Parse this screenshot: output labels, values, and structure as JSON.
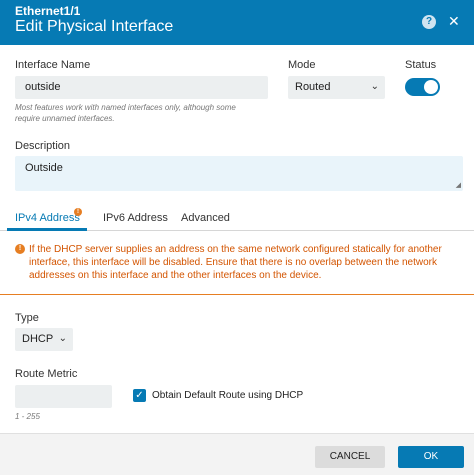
{
  "header": {
    "subtitle": "Ethernet1/1",
    "title": "Edit Physical Interface",
    "help_glyph": "?",
    "close_glyph": "✕"
  },
  "form": {
    "interface_name": {
      "label": "Interface Name",
      "value": "outside",
      "hint": "Most features work with named interfaces only, although some require unnamed interfaces."
    },
    "mode": {
      "label": "Mode",
      "value": "Routed"
    },
    "status": {
      "label": "Status",
      "enabled": true
    },
    "description": {
      "label": "Description",
      "value": "Outside"
    }
  },
  "tabs": [
    {
      "label": "IPv4 Address",
      "active": true,
      "warning": true
    },
    {
      "label": "IPv6 Address",
      "active": false
    },
    {
      "label": "Advanced",
      "active": false
    }
  ],
  "ipv4": {
    "warning": "If the DHCP server supplies an address on the same network configured statically for another interface, this interface will be disabled. Ensure that there is no overlap between the network addresses on this interface and the other interfaces on the device.",
    "type": {
      "label": "Type",
      "value": "DHCP"
    },
    "route_metric": {
      "label": "Route Metric",
      "value": "",
      "hint": "1 - 255"
    },
    "default_route": {
      "label": "Obtain Default Route using DHCP",
      "checked": true
    }
  },
  "footer": {
    "cancel_label": "CANCEL",
    "ok_label": "OK"
  },
  "colors": {
    "primary": "#067ab4",
    "warning": "#e67e22",
    "warning_text": "#d35400"
  }
}
